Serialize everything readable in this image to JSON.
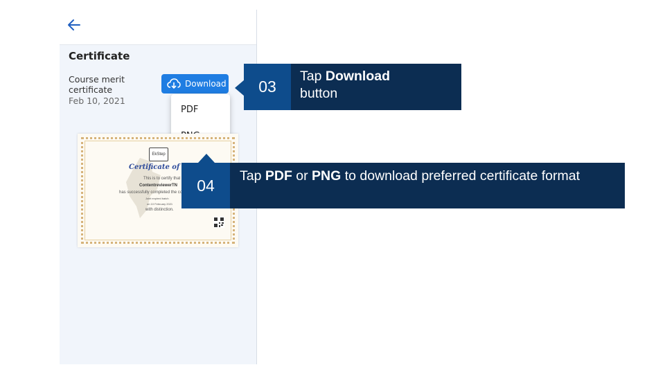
{
  "page": {
    "section_title": "Certificate",
    "certificate": {
      "name": "Course merit certificate",
      "date": "Feb 10, 2021"
    },
    "download_button": {
      "label": "Download",
      "icon": "cloud-download-icon"
    },
    "download_menu": {
      "items": [
        "PDF",
        "PNG"
      ]
    }
  },
  "certificate_preview": {
    "logo": "EkStep",
    "heading": "Certificate of Merit",
    "lines": [
      "This is to certify that",
      "ContentreviewerTN",
      "has successfully completed the course",
      "Joint expired batch",
      "on 10 February 2021",
      "with distinction."
    ]
  },
  "callouts": {
    "step3": {
      "number": "03",
      "text_pre": "Tap ",
      "text_bold": "Download",
      "text_post": "button"
    },
    "step4": {
      "number": "04",
      "text_pre": "Tap ",
      "bold1": "PDF",
      "mid": " or ",
      "bold2": "PNG",
      "text_post": " to download preferred certificate format"
    }
  },
  "colors": {
    "accent": "#1f7de2",
    "callout_number_bg": "#0e4c8c",
    "callout_text_bg": "#0c2d52"
  }
}
